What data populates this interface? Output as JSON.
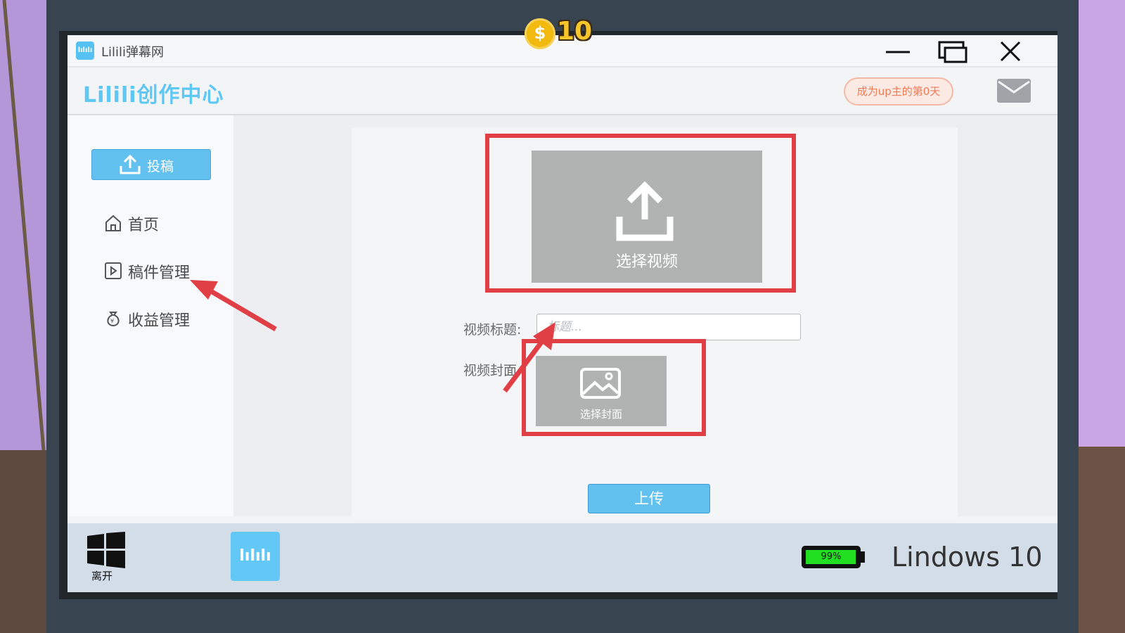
{
  "hud": {
    "coins": "10",
    "coin_symbol": "$"
  },
  "window": {
    "app_icon_text": "lılılı",
    "title": "Lilili弹幕网",
    "buttons": [
      "minimize",
      "restore",
      "close"
    ]
  },
  "header": {
    "brand": "Lilili创作中心",
    "up_days_label": "成为up主的第0天",
    "mail_icon": "mail-icon"
  },
  "sidebar": {
    "post_label": "投稿",
    "items": [
      {
        "label": "首页",
        "icon": "home-icon"
      },
      {
        "label": "稿件管理",
        "icon": "video-manage-icon"
      },
      {
        "label": "收益管理",
        "icon": "money-bag-icon"
      }
    ]
  },
  "upload": {
    "select_video_label": "选择视频",
    "title_label": "视频标题:",
    "title_placeholder": "标题...",
    "title_value": "",
    "cover_label": "视频封面",
    "select_cover_label": "选择封面",
    "submit_label": "上传"
  },
  "taskbar": {
    "leave_label": "离开",
    "app_label": "lılılı",
    "battery_percent": 99,
    "battery_text": "99%",
    "os_name": "Lindows 10"
  },
  "colors": {
    "accent": "#63c1ef",
    "brand": "#5ec8f5",
    "highlight_red": "#e04045",
    "battery_green": "#21e021"
  }
}
